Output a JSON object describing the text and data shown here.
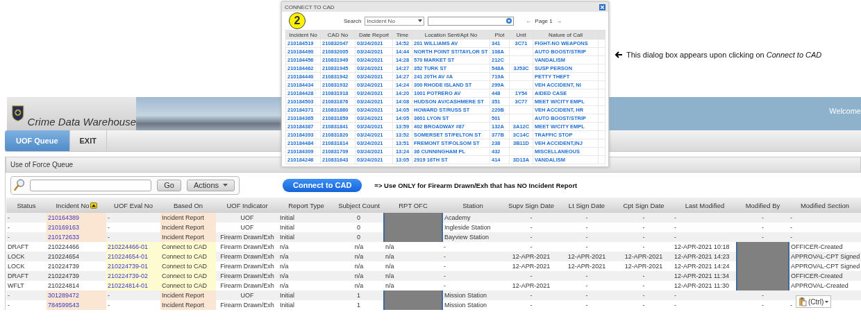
{
  "annotation": {
    "badge": "2",
    "note": "This dialog box appears upon clicking on *Connect to CAD*"
  },
  "dialog": {
    "title": "CONNECT TO CAD",
    "search_label": "Search",
    "search_by": "Incident No",
    "pager": {
      "prev": "←",
      "page": "Page 1",
      "next": "→"
    },
    "columns": [
      "Incident No",
      "CAD No",
      "Date Report",
      "Time",
      "Location Sent/Apt No",
      "Plot",
      "Unit",
      "Nature of Call"
    ],
    "rows": [
      {
        "incident_no": "210184519",
        "cad_no": "210832047",
        "date": "03/24/2021",
        "time": "14:52",
        "location": "201 WILLIAMS AV",
        "plot": "341",
        "unit": "3C71",
        "nature": "FIGHT-NO WEAPONS"
      },
      {
        "incident_no": "210184490",
        "cad_no": "210832005",
        "date": "03/24/2021",
        "time": "14:44",
        "location": "NORTH POINT ST/TAYLOR ST",
        "plot": "108A",
        "nature": "AUTO BOOST/STRIP"
      },
      {
        "incident_no": "210184456",
        "cad_no": "210831949",
        "date": "03/24/2021",
        "time": "14:28",
        "location": "570 MARKET ST",
        "plot": "212C",
        "nature": "VANDALISM"
      },
      {
        "incident_no": "210184462",
        "cad_no": "210831945",
        "date": "03/24/2021",
        "time": "14:27",
        "location": "352 TURK ST",
        "plot": "548A",
        "unit": "3J53C",
        "nature": "SUSP PERSON"
      },
      {
        "incident_no": "210184440",
        "cad_no": "210831942",
        "date": "03/24/2021",
        "time": "14:27",
        "location": "241 20TH AV #A",
        "plot": "719A",
        "nature": "PETTY THEFT"
      },
      {
        "incident_no": "210184434",
        "cad_no": "210831932",
        "date": "03/24/2021",
        "time": "14:24",
        "location": "300 RHODE ISLAND ST",
        "plot": "299A",
        "nature": "VEH ACCIDENT, NI"
      },
      {
        "incident_no": "210184428",
        "cad_no": "210831918",
        "date": "03/24/2021",
        "time": "14:20",
        "location": "1001 POTRERO AV",
        "plot": "448",
        "unit": "1Y54",
        "nature": "AIDED CASE"
      },
      {
        "incident_no": "210184503",
        "cad_no": "210831876",
        "date": "03/24/2021",
        "time": "14:08",
        "location": "HUDSON AV/CASHMERE ST",
        "plot": "351",
        "unit": "3C77",
        "nature": "MEET W/CITY EMPL"
      },
      {
        "incident_no": "210184371",
        "cad_no": "210831860",
        "date": "03/24/2021",
        "time": "14:05",
        "location": "HOWARD ST/RUSS ST",
        "plot": "220B",
        "nature": "VEH ACCIDENT, HR"
      },
      {
        "incident_no": "210184365",
        "cad_no": "210831859",
        "date": "03/24/2021",
        "time": "14:05",
        "location": "3601 LYON ST",
        "plot": "501",
        "nature": "AUTO BOOST/STRIP"
      },
      {
        "incident_no": "210184387",
        "cad_no": "210831841",
        "date": "03/24/2021",
        "time": "13:59",
        "location": "402 BROADWAY #87",
        "plot": "132A",
        "unit": "3A12C",
        "nature": "MEET W/CITY EMPL"
      },
      {
        "incident_no": "210184393",
        "cad_no": "210831820",
        "date": "03/24/2021",
        "time": "13:52",
        "location": "SOMERSET ST/FELTON ST",
        "plot": "377B",
        "unit": "3C14C",
        "nature": "TRAFFIC STOP"
      },
      {
        "incident_no": "210184484",
        "cad_no": "210831814",
        "date": "03/24/2021",
        "time": "13:51",
        "location": "FREMONT ST/FOLSOM ST",
        "plot": "238",
        "unit": "3B11D",
        "nature": "VEH ACCIDENT,INJ"
      },
      {
        "incident_no": "210184309",
        "cad_no": "210831709",
        "date": "03/24/2021",
        "time": "13:24",
        "location": "36 CUNNINGHAM PL",
        "plot": "432",
        "nature": "MISCELLANEOUS"
      },
      {
        "incident_no": "210184246",
        "cad_no": "210831643",
        "date": "03/24/2021",
        "time": "13:05",
        "location": "2919 16TH ST",
        "plot": "414",
        "unit": "3D13A",
        "nature": "VANDALISM"
      }
    ]
  },
  "header": {
    "title": "Crime Data Warehouse",
    "welcome": "Welcome"
  },
  "nav": {
    "tabs": [
      {
        "label": "UOF Queue",
        "selected": true
      },
      {
        "label": "EXIT",
        "selected": false
      }
    ]
  },
  "panel": {
    "title": "Use of Force Queue",
    "toolbar": {
      "go": "Go",
      "actions": "Actions",
      "connect": "Connect to CAD",
      "note": "=> Use ONLY for Firearm Drawn/Exh that has NO Incident Report"
    }
  },
  "table": {
    "columns": [
      {
        "label": "Status",
        "sorted": false
      },
      {
        "label": "Incident No",
        "sorted": true
      },
      {
        "label": "UOF Eval No",
        "sorted": false
      },
      {
        "label": "Based On",
        "sorted": false
      },
      {
        "label": "UOF Indicator",
        "sorted": false
      },
      {
        "label": "Report Type",
        "sorted": false
      },
      {
        "label": "Subject Count",
        "sorted": false
      },
      {
        "label": "RPT OFC",
        "sorted": false
      },
      {
        "label": "Station",
        "sorted": false
      },
      {
        "label": "Supv Sign Date",
        "sorted": false
      },
      {
        "label": "Lt Sign Date",
        "sorted": false
      },
      {
        "label": "Cpt Sign Date",
        "sorted": false
      },
      {
        "label": "Last Modified",
        "sorted": false
      },
      {
        "label": "Modified By",
        "sorted": false
      },
      {
        "label": "Modified Section",
        "sorted": false
      }
    ],
    "rows": [
      {
        "kind": "incident_report",
        "status": "-",
        "incident_no": "210164389",
        "uof_eval_no": "-",
        "based_on": "Incident Report",
        "uof_indicator": "UOF",
        "report_type": "Initial",
        "subject_count": "0",
        "rpt_ofc_hidden": true,
        "station": "Academy",
        "supv_sign_date": "-",
        "lt_sign_date": "-",
        "cpt_sign_date": "-",
        "last_modified": "-",
        "modified_by": "-",
        "modified_by_hidden": false,
        "modified_section": "-"
      },
      {
        "kind": "incident_report",
        "status": "-",
        "incident_no": "210169163",
        "uof_eval_no": "-",
        "based_on": "Incident Report",
        "uof_indicator": "UOF",
        "report_type": "Initial",
        "subject_count": "0",
        "rpt_ofc_hidden": true,
        "station": "Ingleside Station",
        "supv_sign_date": "-",
        "lt_sign_date": "-",
        "cpt_sign_date": "-",
        "last_modified": "-",
        "modified_by": "-",
        "modified_by_hidden": false,
        "modified_section": "-"
      },
      {
        "kind": "incident_report",
        "status": "-",
        "incident_no": "210172633",
        "uof_eval_no": "-",
        "based_on": "Incident Report",
        "uof_indicator": "Firearm Drawn/Exh",
        "report_type": "Initial",
        "subject_count": "0",
        "rpt_ofc_hidden": true,
        "station": "Bayview Station",
        "supv_sign_date": "-",
        "lt_sign_date": "-",
        "cpt_sign_date": "-",
        "last_modified": "-",
        "modified_by": "-",
        "modified_by_hidden": false,
        "modified_section": "-"
      },
      {
        "kind": "cad",
        "status": "DRAFT",
        "incident_no": "210224466",
        "uof_eval_no": "210224466-01",
        "based_on": "Connect to CAD",
        "uof_indicator": "Firearm Drawn/Exh",
        "report_type": "n/a",
        "subject_count": "n/a",
        "rpt_ofc": "n/a",
        "rpt_ofc_hidden": false,
        "station": "-",
        "supv_sign_date": "-",
        "lt_sign_date": "-",
        "cpt_sign_date": "-",
        "last_modified": "12-APR-2021 10:18",
        "modified_by_hidden": true,
        "modified_section": "OFFICER-Created"
      },
      {
        "kind": "cad",
        "status": "LOCK",
        "incident_no": "210224654",
        "uof_eval_no": "210224654-01",
        "based_on": "Connect to CAD",
        "uof_indicator": "Firearm Drawn/Exh",
        "report_type": "n/a",
        "subject_count": "n/a",
        "rpt_ofc": "n/a",
        "rpt_ofc_hidden": false,
        "station": "-",
        "supv_sign_date": "12-APR-2021",
        "lt_sign_date": "12-APR-2021",
        "cpt_sign_date": "12-APR-2021",
        "last_modified": "12-APR-2021 14:23",
        "modified_by_hidden": true,
        "modified_section": "APPROVAL-CPT Signed"
      },
      {
        "kind": "cad",
        "status": "LOCK",
        "incident_no": "210224739",
        "uof_eval_no": "210224739-01",
        "based_on": "Connect to CAD",
        "uof_indicator": "Firearm Drawn/Exh",
        "report_type": "n/a",
        "subject_count": "n/a",
        "rpt_ofc": "n/a",
        "rpt_ofc_hidden": false,
        "station": "-",
        "supv_sign_date": "12-APR-2021",
        "lt_sign_date": "12-APR-2021",
        "cpt_sign_date": "12-APR-2021",
        "last_modified": "12-APR-2021 14:24",
        "modified_by_hidden": true,
        "modified_section": "APPROVAL-CPT Signed"
      },
      {
        "kind": "cad",
        "status": "DRAFT",
        "incident_no": "210224739",
        "uof_eval_no": "210224739-02",
        "based_on": "Connect to CAD",
        "uof_indicator": "Firearm Drawn/Exh",
        "report_type": "n/a",
        "subject_count": "n/a",
        "rpt_ofc": "n/a",
        "rpt_ofc_hidden": false,
        "station": "-",
        "supv_sign_date": "-",
        "lt_sign_date": "-",
        "cpt_sign_date": "-",
        "last_modified": "12-APR-2021 11:34",
        "modified_by_hidden": true,
        "modified_section": "OFFICER-Created"
      },
      {
        "kind": "cad",
        "status": "WFLT",
        "incident_no": "210224814",
        "uof_eval_no": "210224814-01",
        "based_on": "Connect to CAD",
        "uof_indicator": "Firearm Drawn/Exh",
        "report_type": "n/a",
        "subject_count": "n/a",
        "rpt_ofc": "n/a",
        "rpt_ofc_hidden": false,
        "station": "-",
        "supv_sign_date": "12-APR-2021",
        "lt_sign_date": "-",
        "cpt_sign_date": "-",
        "last_modified": "12-APR-2021 11:30",
        "modified_by_hidden": true,
        "modified_section": "APPROVAL-Created"
      },
      {
        "kind": "incident_report",
        "status": "-",
        "incident_no": "301289472",
        "uof_eval_no": "-",
        "based_on": "Incident Report",
        "uof_indicator": "UOF",
        "report_type": "Initial",
        "subject_count": "1",
        "rpt_ofc_hidden": true,
        "station": "Mission Station",
        "supv_sign_date": "-",
        "lt_sign_date": "-",
        "cpt_sign_date": "-",
        "last_modified": "-",
        "modified_by": "-",
        "modified_by_hidden": false
      },
      {
        "kind": "incident_report",
        "status": "-",
        "incident_no": "784599543",
        "uof_eval_no": "-",
        "based_on": "Incident Report",
        "uof_indicator": "Firearm Drawn/Exh",
        "report_type": "Initial",
        "subject_count": "1",
        "rpt_ofc_hidden": true,
        "station": "Mission Station",
        "supv_sign_date": "-",
        "lt_sign_date": "-",
        "cpt_sign_date": "-",
        "last_modified": "-",
        "modified_by": "-",
        "modified_by_hidden": false,
        "modified_section": "-"
      }
    ]
  },
  "paste_popup": {
    "label": "(Ctrl)"
  }
}
